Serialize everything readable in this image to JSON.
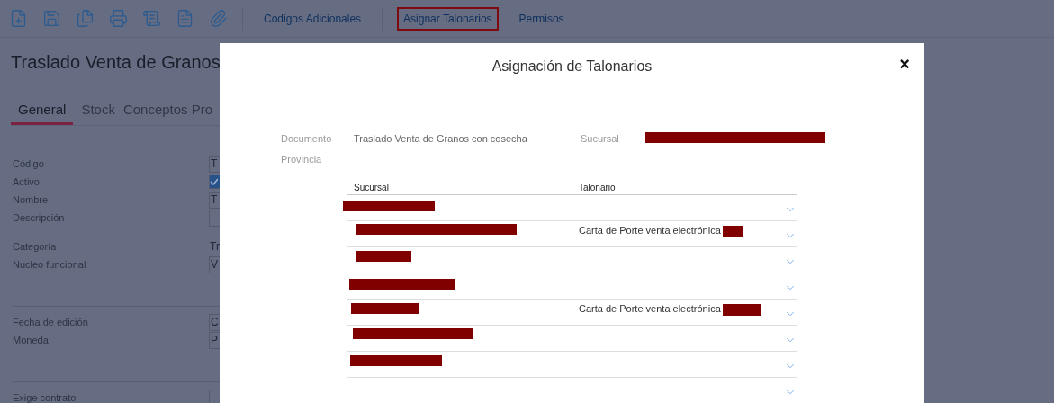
{
  "toolbar": {
    "links": [
      {
        "label": "Codigos Adicionales",
        "highlighted": false
      },
      {
        "label": "Asignar Talonarios",
        "highlighted": true
      },
      {
        "label": "Permisos",
        "highlighted": false
      }
    ]
  },
  "page": {
    "title": "Traslado Venta de Granos",
    "tabs": [
      {
        "label": "General",
        "selected": true
      },
      {
        "label": "Stock",
        "selected": false
      },
      {
        "label": "Conceptos Pro",
        "selected": false
      }
    ],
    "fields": [
      {
        "label": "Código",
        "kind": "input",
        "value": "T"
      },
      {
        "label": "Activo",
        "kind": "checkbox",
        "checked": true
      },
      {
        "label": "Nombre",
        "kind": "input",
        "value": "T"
      },
      {
        "label": "Descripción",
        "kind": "input"
      },
      {
        "label": "Categoría",
        "kind": "text",
        "value": "Tr",
        "group_start": true
      },
      {
        "label": "Nucleo funcional",
        "kind": "input",
        "value": "V"
      },
      {
        "label": "Fecha de edición",
        "kind": "input",
        "value": "C",
        "group_start": true,
        "divider": true
      },
      {
        "label": "Moneda",
        "kind": "input",
        "value": "P"
      },
      {
        "label": "Exige contrato",
        "kind": "input",
        "divider": true
      }
    ]
  },
  "dialog": {
    "title": "Asignación de Talonarios",
    "close": "×",
    "info": {
      "documento_label": "Documento",
      "documento": "Traslado Venta de Granos con cosecha",
      "sucursal_label": "Sucursal",
      "sucursal_redacted": true,
      "provincia_label": "Provincia"
    },
    "table": {
      "columns": [
        "Sucursal",
        "Talonario"
      ],
      "rows": [
        {
          "sucursal_redacted": true,
          "expanded": false
        },
        {
          "sucursal_redacted": true,
          "talonario": "Carta de Porte venta electrónica",
          "talonario_redacted": true,
          "expanded": false
        },
        {
          "sucursal_redacted": true,
          "expanded": false
        },
        {
          "sucursal_redacted": true,
          "expanded": false
        },
        {
          "sucursal_redacted": true,
          "talonario": "Carta de Porte venta electrónica",
          "talonario_redacted": true,
          "expanded": false
        },
        {
          "sucursal_redacted": true,
          "expanded": false
        },
        {
          "sucursal_redacted": true,
          "expanded": false
        },
        {
          "expanded": false
        }
      ]
    }
  }
}
